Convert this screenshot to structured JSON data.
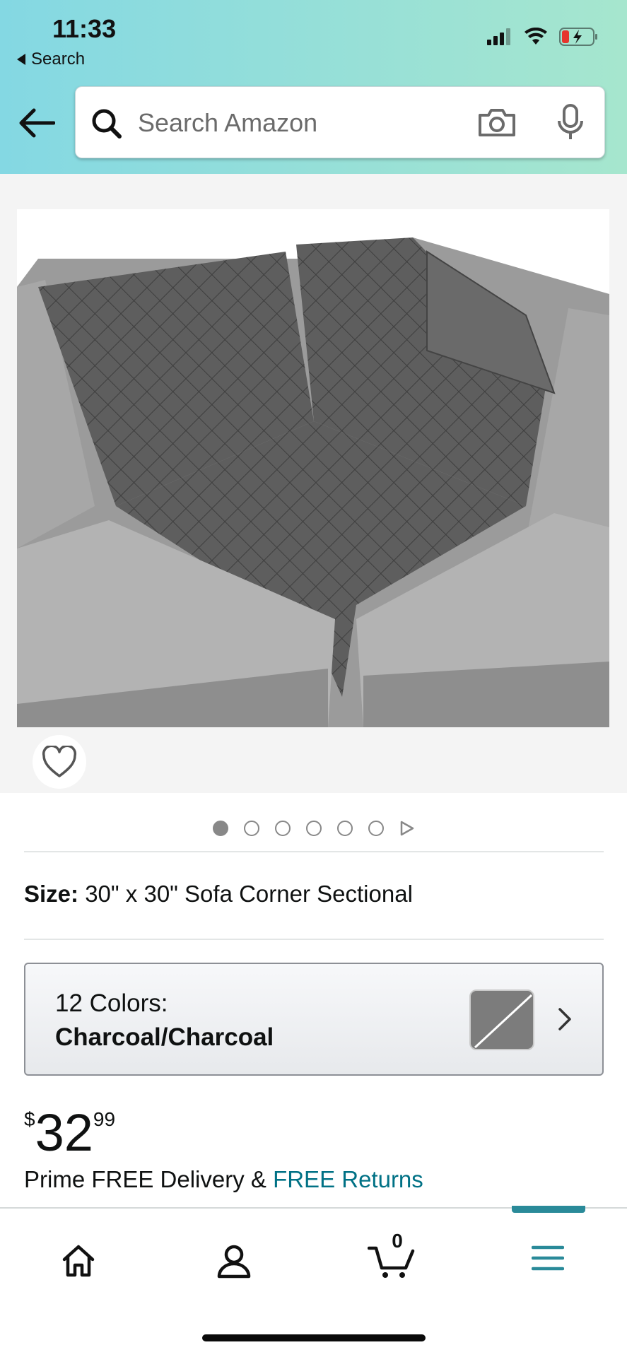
{
  "status_bar": {
    "time": "11:33",
    "back_label": "Search",
    "icons": [
      "cellular-signal-icon",
      "wifi-icon",
      "battery-charging-icon"
    ]
  },
  "header": {
    "search_placeholder": "Search Amazon",
    "icons": [
      "back-arrow-icon",
      "search-icon",
      "camera-icon",
      "microphone-icon"
    ],
    "gradient_colors": [
      "#84d8e3",
      "#a6e6ce"
    ]
  },
  "product_image": {
    "alt": "Quilted charcoal corner sofa cover on grey sectional",
    "total_images": 6,
    "current_index": 1
  },
  "size": {
    "label": "Size:",
    "value": "30\" x 30\" Sofa Corner Sectional"
  },
  "color_selector": {
    "count_label": "12 Colors:",
    "selected": "Charcoal/Charcoal",
    "swatch_color": "#7c7c7c"
  },
  "price": {
    "symbol": "$",
    "whole": "32",
    "fraction": "99"
  },
  "delivery": {
    "text": "Prime FREE Delivery & ",
    "link": "FREE Returns"
  },
  "bottom_nav": {
    "items": [
      "home",
      "account",
      "cart",
      "menu"
    ],
    "cart_count": "0",
    "active_color": "#2a8a99"
  }
}
